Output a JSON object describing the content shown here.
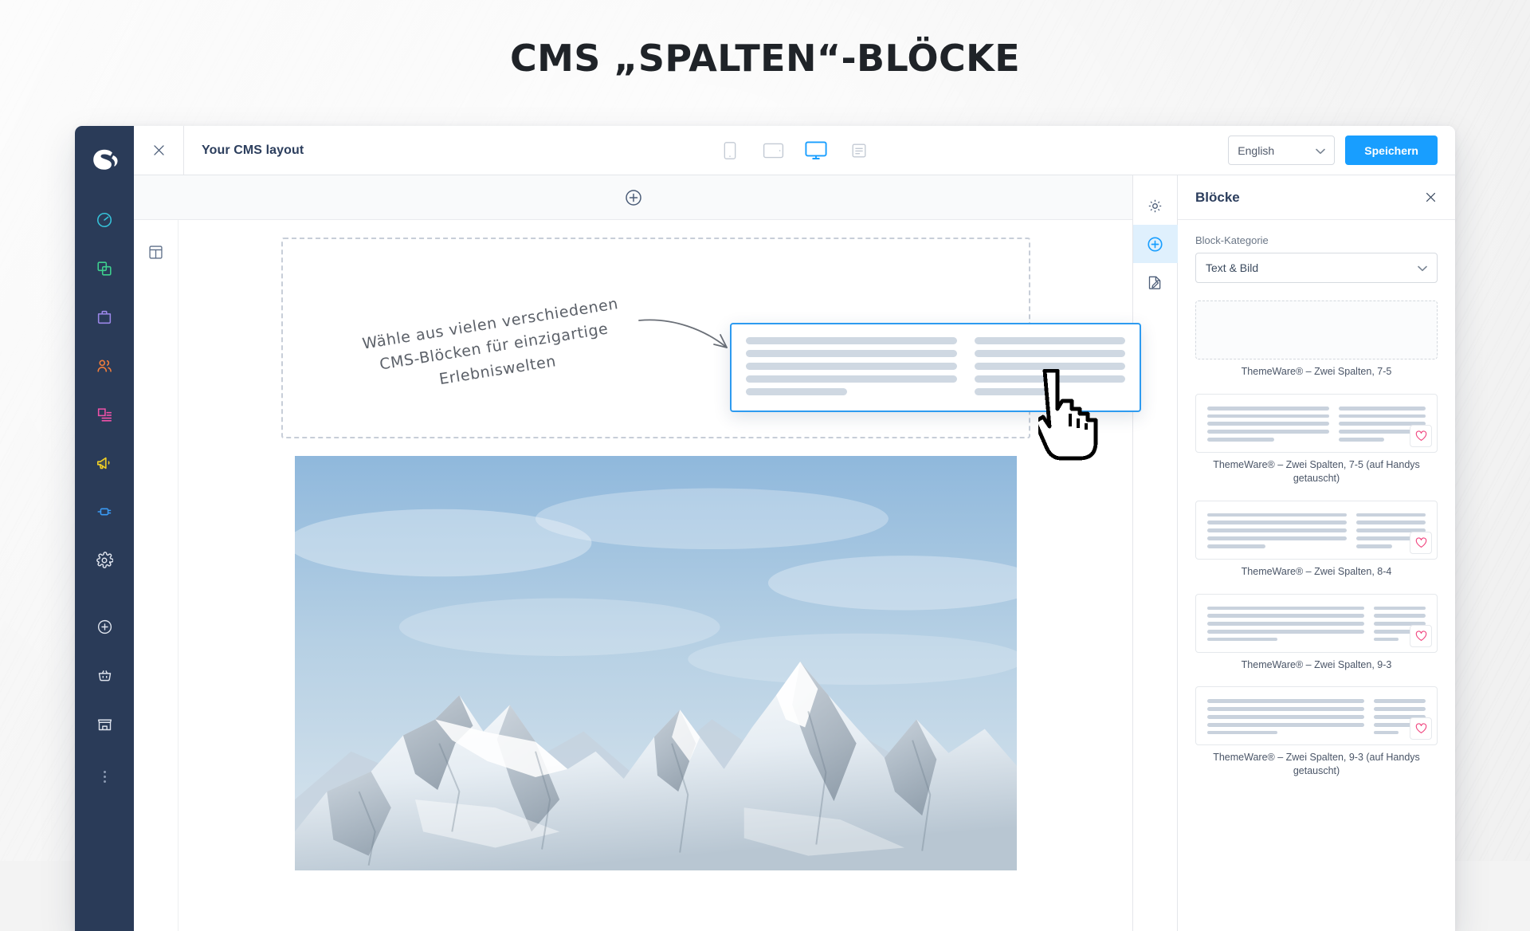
{
  "headline": "CMS „SPALTEN“-BLÖCKE",
  "admin_rail": {
    "logo_name": "shopware-logo",
    "items": [
      {
        "icon": "dashboard-gauge-icon",
        "color": "#36c2d9"
      },
      {
        "icon": "catalogues-layers-icon",
        "color": "#3ecf8e"
      },
      {
        "icon": "orders-bag-icon",
        "color": "#9b87e8"
      },
      {
        "icon": "customers-people-icon",
        "color": "#f07d3c"
      },
      {
        "icon": "content-page-icon",
        "color": "#ef52a8"
      },
      {
        "icon": "marketing-megaphone-icon",
        "color": "#f2d024"
      },
      {
        "icon": "extensions-plug-icon",
        "color": "#3a9bf5"
      },
      {
        "icon": "settings-gear-icon",
        "color": "#ffffff"
      },
      {
        "icon": "add-circle-icon",
        "color": "#ffffff"
      },
      {
        "icon": "basket-icon",
        "color": "#ffffff"
      },
      {
        "icon": "shop-storefront-icon",
        "color": "#ffffff"
      }
    ],
    "more_icon": "more-vertical-icon"
  },
  "toolbar": {
    "close_icon": "close-icon",
    "title": "Your CMS layout",
    "devices": [
      {
        "name": "mobile",
        "icon": "mobile-icon",
        "active": false
      },
      {
        "name": "tablet",
        "icon": "tablet-icon",
        "active": false
      },
      {
        "name": "desktop",
        "icon": "desktop-icon",
        "active": true
      },
      {
        "name": "form",
        "icon": "list-view-icon",
        "active": false
      }
    ],
    "language_value": "English",
    "language_chevron": "chevron-down-icon",
    "save_label": "Speichern",
    "accent_color": "#189eff"
  },
  "editor": {
    "add_section_icon": "add-circle-icon",
    "section_rail_icon": "section-layout-icon",
    "drop_zone_name": "empty-block-drop-zone",
    "image_block_name": "mountain-image-block"
  },
  "tool_rail": {
    "items": [
      {
        "icon": "settings-gear-icon",
        "name": "tab-settings",
        "active": false
      },
      {
        "icon": "add-circle-icon",
        "name": "tab-blocks",
        "active": true
      },
      {
        "icon": "edit-page-icon",
        "name": "tab-layout",
        "active": false
      }
    ],
    "active_color": "#189eff",
    "active_bg": "#dff0fd"
  },
  "blocks_panel": {
    "title": "Blöcke",
    "close_icon": "close-icon",
    "category_label": "Block-Kategorie",
    "category_value": "Text & Bild",
    "category_chevron": "chevron-down-icon",
    "favorite_icon": "heart-outline-icon",
    "favorite_color": "#f0457f",
    "items": [
      {
        "caption": "ThemeWare® – Zwei Spalten, 7-5",
        "style": "dotted",
        "favorite": false,
        "left_lines": [],
        "right_lines": []
      },
      {
        "caption": "ThemeWare® – Zwei Spalten, 7-5 (auf Handys getauscht)",
        "style": "solid",
        "favorite": true,
        "left_ratio": 7,
        "right_ratio": 5,
        "left_lines": [
          100,
          100,
          100,
          100,
          55
        ],
        "right_lines": [
          100,
          100,
          100,
          100,
          52
        ]
      },
      {
        "caption": "ThemeWare® – Zwei Spalten, 8-4",
        "style": "solid",
        "favorite": true,
        "left_ratio": 8,
        "right_ratio": 4,
        "left_lines": [
          100,
          100,
          100,
          100,
          42
        ],
        "right_lines": [
          100,
          100,
          100,
          100,
          52
        ]
      },
      {
        "caption": "ThemeWare® – Zwei Spalten, 9-3",
        "style": "solid",
        "favorite": true,
        "left_ratio": 9,
        "right_ratio": 3,
        "left_lines": [
          100,
          100,
          100,
          100,
          45
        ],
        "right_lines": [
          100,
          100,
          100,
          100,
          48
        ]
      },
      {
        "caption": "ThemeWare® – Zwei Spalten, 9-3 (auf Handys getauscht)",
        "style": "solid",
        "favorite": true,
        "left_ratio": 9,
        "right_ratio": 3,
        "left_lines": [
          100,
          100,
          100,
          100,
          45
        ],
        "right_lines": [
          100,
          100,
          100,
          100,
          48
        ]
      }
    ]
  },
  "drag_block": {
    "name": "dragged-two-column-block",
    "border_color": "#2e9bf0",
    "left_lines": [
      100,
      100,
      100,
      100,
      48
    ],
    "right_lines": [
      100,
      100,
      100,
      100,
      52
    ]
  },
  "annotation": {
    "line1": "Wähle aus vielen verschiedenen",
    "line2": "CMS-Blöcken für einzigartige",
    "line3": "Erlebniswelten",
    "arrow_name": "annotation-arrow"
  },
  "cursor": {
    "name": "hand-pointer-cursor"
  }
}
